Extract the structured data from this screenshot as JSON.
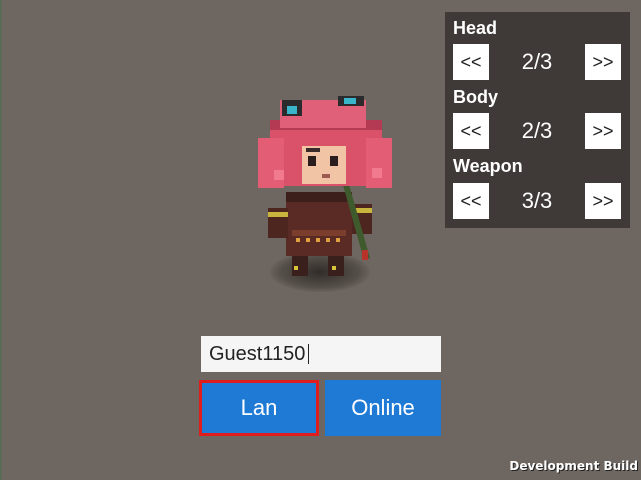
{
  "customization": {
    "rows": [
      {
        "label": "Head",
        "prev": "<<",
        "next": ">>",
        "value": "2/3"
      },
      {
        "label": "Body",
        "prev": "<<",
        "next": ">>",
        "value": "2/3"
      },
      {
        "label": "Weapon",
        "prev": "<<",
        "next": ">>",
        "value": "3/3"
      }
    ]
  },
  "player": {
    "name": "Guest1150"
  },
  "buttons": {
    "lan": "Lan",
    "online": "Online"
  },
  "footer": {
    "build_label": "Development Build"
  },
  "colors": {
    "background": "#6e6761",
    "panel": "#3f3a37",
    "button_blue": "#1f7ad6",
    "selected_outline": "#e01d1d"
  }
}
